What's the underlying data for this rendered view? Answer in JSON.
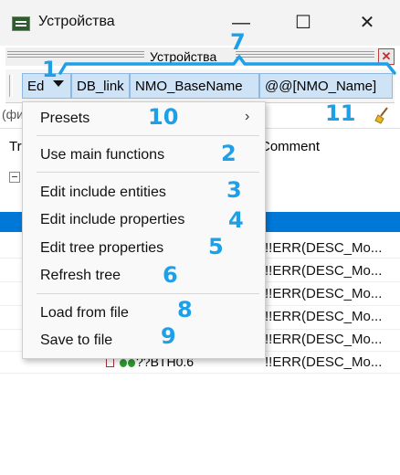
{
  "window": {
    "title": "Устройства",
    "minimize": "—",
    "maximize": "☐",
    "close": "✕"
  },
  "panel": {
    "title": "Устройства",
    "close": "✕"
  },
  "columns": [
    "Ed",
    "DB_link",
    "NMO_BaseName",
    "@@[NMO_Name]"
  ],
  "filter": {
    "text": "(фи"
  },
  "tree": {
    "header_tr": "Tr",
    "header_comment": "Comment",
    "err_rows": [
      "!!ERR(DESC_Mo...",
      "!!ERR(DESC_Mo...",
      "!!ERR(DESC_Mo...",
      "!!ERR(DESC_Mo...",
      "!!ERR(DESC_Mo...",
      "!!ERR(DESC_Mo..."
    ],
    "leaf": "??BTH0.6"
  },
  "menu": {
    "items": [
      {
        "label": "Presets",
        "has_submenu": true
      },
      {
        "label": "Use main functions"
      },
      {
        "label": "Edit include entities"
      },
      {
        "label": "Edit include properties"
      },
      {
        "label": "Edit tree properties"
      },
      {
        "label": "Refresh tree"
      },
      {
        "label": "Load from file"
      },
      {
        "label": "Save to file"
      }
    ],
    "submenu_arrow": "›"
  },
  "annotations": [
    "1",
    "2",
    "3",
    "4",
    "5",
    "6",
    "7",
    "8",
    "9",
    "10",
    "11"
  ],
  "colors": {
    "accent": "#1ea0e8",
    "selection": "#0078d7",
    "column_header": "#cfe3f7"
  }
}
